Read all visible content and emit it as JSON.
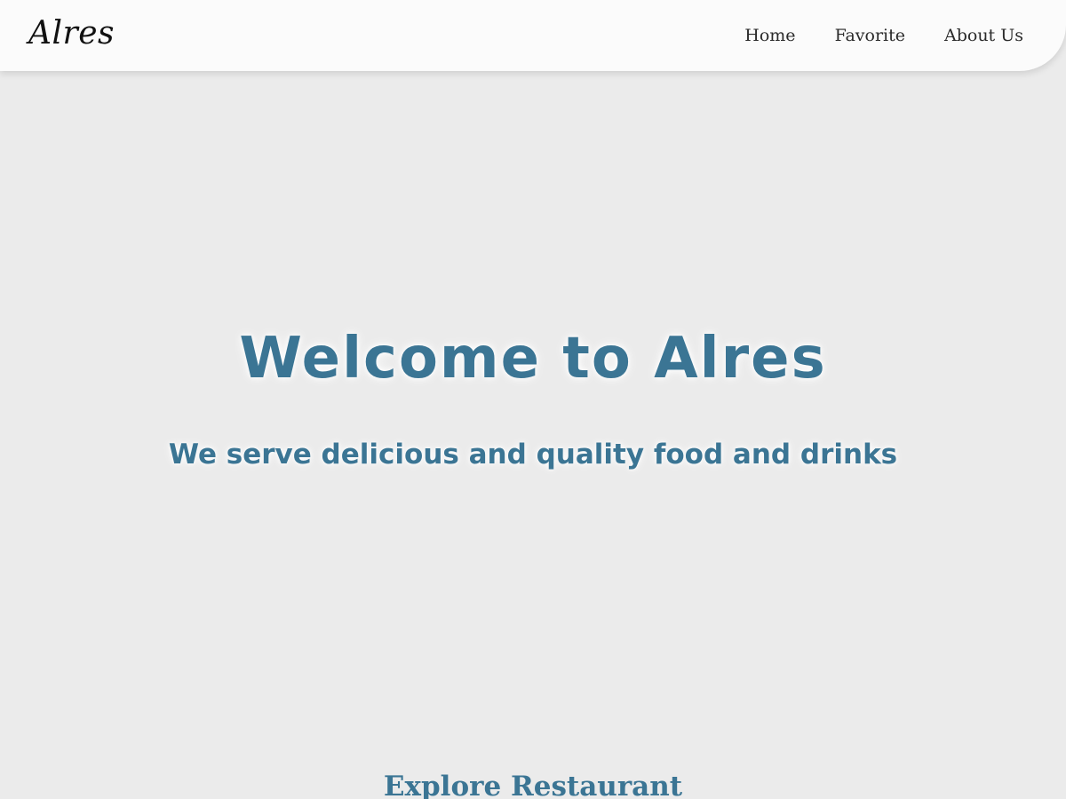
{
  "header": {
    "brand": "Alres",
    "nav": [
      {
        "label": "Home"
      },
      {
        "label": "Favorite"
      },
      {
        "label": "About Us"
      }
    ]
  },
  "hero": {
    "title": "Welcome to Alres",
    "subtitle": "We serve delicious and quality food and drinks"
  },
  "explore": {
    "title": "Explore Restaurant"
  },
  "colors": {
    "background": "#ebebeb",
    "header_bg": "#fbfbfb",
    "accent": "#3b7594",
    "nav_text": "#2a2a2a"
  }
}
